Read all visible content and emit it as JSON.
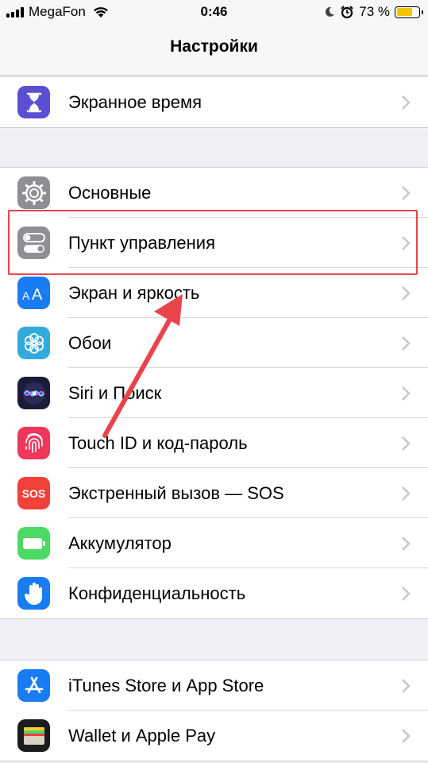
{
  "status_bar": {
    "carrier": "MegaFon",
    "time": "0:46",
    "battery_percent": "73 %",
    "battery_level": 0.73
  },
  "nav": {
    "title": "Настройки"
  },
  "groups": [
    {
      "items": [
        {
          "label": "Экранное время",
          "icon": "hourglass-icon",
          "color": "#5b4fd1"
        }
      ]
    },
    {
      "items": [
        {
          "label": "Основные",
          "icon": "gear-icon",
          "color": "#8e8e93"
        },
        {
          "label": "Пункт управления",
          "icon": "toggles-icon",
          "color": "#8e8e93"
        },
        {
          "label": "Экран и яркость",
          "icon": "text-size-icon",
          "color": "#1a7cf2"
        },
        {
          "label": "Обои",
          "icon": "flower-icon",
          "color": "#34aadc"
        },
        {
          "label": "Siri и Поиск",
          "icon": "siri-icon",
          "color": "#1c1c3a"
        },
        {
          "label": "Touch ID и код-пароль",
          "icon": "fingerprint-icon",
          "color": "#f0365b"
        },
        {
          "label": "Экстренный вызов — SOS",
          "icon": "sos-icon",
          "color": "#f0403a",
          "icon_text": "SOS"
        },
        {
          "label": "Аккумулятор",
          "icon": "battery-icon",
          "color": "#4cd964"
        },
        {
          "label": "Конфиденциальность",
          "icon": "hand-icon",
          "color": "#1a7cf2"
        }
      ]
    },
    {
      "items": [
        {
          "label": "iTunes Store и App Store",
          "icon": "app-store-icon",
          "color": "#1a7cf2"
        },
        {
          "label": "Wallet и Apple Pay",
          "icon": "wallet-icon",
          "color": "#1c1c1e"
        }
      ]
    }
  ],
  "annotation": {
    "highlight_color": "#e8444b"
  }
}
